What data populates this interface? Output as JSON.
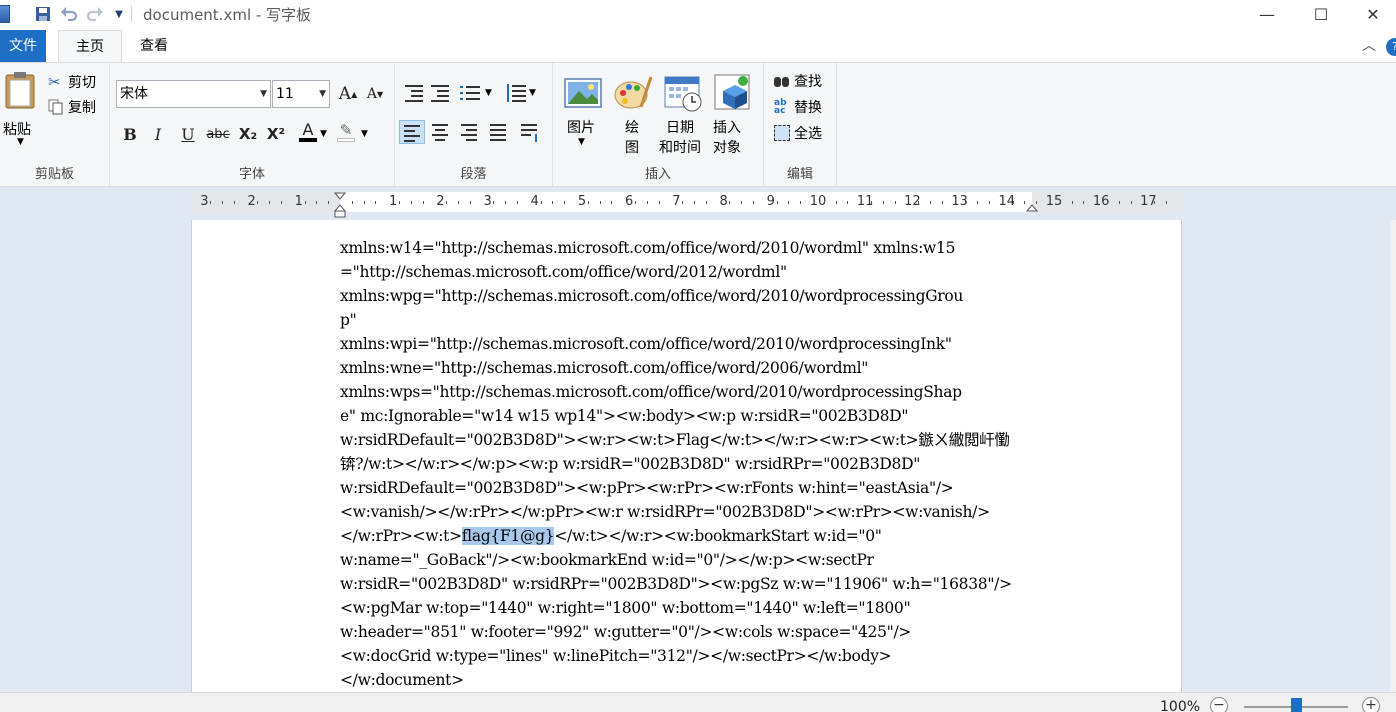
{
  "window": {
    "title": "document.xml - 写字板",
    "minimize": "—",
    "maximize": "☐",
    "close": "✕"
  },
  "quick_access": {
    "save_icon": "floppy-disk-icon",
    "undo_icon": "undo-icon",
    "redo_icon": "redo-icon",
    "customize_icon": "chevron-down-icon"
  },
  "tabs": [
    {
      "label": "文件"
    },
    {
      "label": "主页"
    },
    {
      "label": "查看"
    }
  ],
  "ribbon": {
    "clipboard": {
      "group_label": "剪贴板",
      "paste": "粘贴",
      "cut": "剪切",
      "copy": "复制"
    },
    "font": {
      "group_label": "字体",
      "font_family": "宋体",
      "font_size": "11",
      "bold": "B",
      "italic": "I",
      "underline": "U",
      "strikethrough": "abc",
      "subscript": "X₂",
      "superscript": "X²",
      "font_color": "A",
      "highlight": "✎",
      "grow": "A",
      "shrink": "A"
    },
    "paragraph": {
      "group_label": "段落"
    },
    "insert": {
      "group_label": "插入",
      "picture": "图片",
      "paint_line1": "绘",
      "paint_line2": "图",
      "datetime_line1": "日期",
      "datetime_line2": "和时间",
      "object_line1": "插入",
      "object_line2": "对象"
    },
    "edit": {
      "group_label": "编辑",
      "find": "查找",
      "replace": "替换",
      "select_all": "全选"
    }
  },
  "ruler": {
    "labels": [
      "3",
      "2",
      "1",
      "1",
      "2",
      "3",
      "4",
      "5",
      "6",
      "7",
      "8",
      "9",
      "10",
      "11",
      "12",
      "13",
      "14",
      "15",
      "16",
      "17"
    ]
  },
  "document": {
    "lines": [
      "xmlns:w14=\"http://schemas.microsoft.com/office/word/2010/wordml\" xmlns:w15",
      "=\"http://schemas.microsoft.com/office/word/2012/wordml\"",
      "xmlns:wpg=\"http://schemas.microsoft.com/office/word/2010/wordprocessingGrou",
      "p\"",
      "xmlns:wpi=\"http://schemas.microsoft.com/office/word/2010/wordprocessingInk\"",
      "xmlns:wne=\"http://schemas.microsoft.com/office/word/2006/wordml\"",
      "xmlns:wps=\"http://schemas.microsoft.com/office/word/2010/wordprocessingShap",
      "e\" mc:Ignorable=\"w14 w15 wp14\"><w:body><w:p w:rsidR=\"002B3D8D\"",
      "w:rsidRDefault=\"002B3D8D\"><w:r><w:t>Flag</w:t></w:r><w:r><w:t>鏃ㄨ繖閲屽懄",
      "锛?/w:t></w:r></w:p><w:p w:rsidR=\"002B3D8D\" w:rsidRPr=\"002B3D8D\"",
      "w:rsidRDefault=\"002B3D8D\"><w:pPr><w:rPr><w:rFonts w:hint=\"eastAsia\"/>",
      "<w:vanish/></w:rPr></w:pPr><w:r w:rsidRPr=\"002B3D8D\"><w:rPr><w:vanish/>",
      null,
      "w:name=\"_GoBack\"/><w:bookmarkEnd w:id=\"0\"/></w:p><w:sectPr",
      "w:rsidR=\"002B3D8D\" w:rsidRPr=\"002B3D8D\"><w:pgSz w:w=\"11906\" w:h=\"16838\"/>",
      "<w:pgMar w:top=\"1440\" w:right=\"1800\" w:bottom=\"1440\" w:left=\"1800\"",
      "w:header=\"851\" w:footer=\"992\" w:gutter=\"0\"/><w:cols w:space=\"425\"/>",
      "<w:docGrid w:type=\"lines\" w:linePitch=\"312\"/></w:sectPr></w:body>",
      "</w:document>"
    ],
    "line13_before": "</w:rPr><w:t>",
    "line13_selected": "flag{F1@g}",
    "line13_after": "</w:t></w:r><w:bookmarkStart w:id=\"0\""
  },
  "status": {
    "zoom": "100%",
    "zoom_out": "−",
    "zoom_in": "+",
    "zoom_level": 0.5
  },
  "colors": {
    "accent": "#1e6fc4",
    "selection": "#a9c9ec",
    "ribbon_bg": "#f5f6f7",
    "workspace_bg": "#dfe8f3"
  }
}
